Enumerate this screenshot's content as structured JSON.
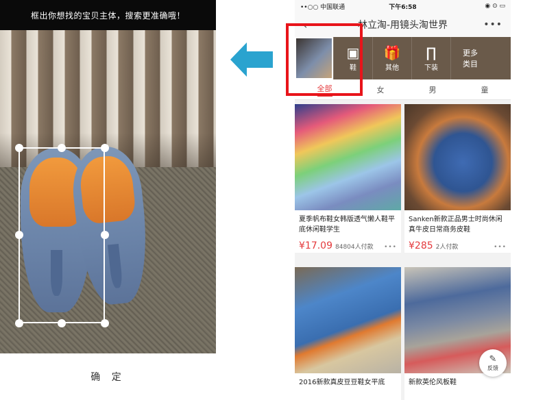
{
  "left_panel": {
    "hint": "框出你想找的宝贝主体，搜索更准确哦！",
    "confirm_label": "确 定"
  },
  "phone": {
    "status": {
      "carrier": "••○○ 中国联通",
      "time": "下午6:58",
      "battery": "◉ ⊙ ▭"
    },
    "nav": {
      "back": "‹",
      "title": "林立淘-用镜头淘世界",
      "more": "•••"
    },
    "categories": [
      {
        "icon": "▣",
        "label": "鞋",
        "icon_name": "shoe-category-icon"
      },
      {
        "icon": "🎁",
        "label": "其他",
        "icon_name": "gift-icon"
      },
      {
        "icon": "∏",
        "label": "下装",
        "icon_name": "pants-icon"
      },
      {
        "icon": "",
        "label": "更多\n类目",
        "icon_name": "more-categories"
      }
    ],
    "gender_tabs": [
      "全部",
      "女",
      "男",
      "童"
    ],
    "products": [
      {
        "desc": "夏季帆布鞋女韩版透气懒人鞋平底休闲鞋学生",
        "price": "¥17.09",
        "sold": "84804人付款",
        "dots": "•••"
      },
      {
        "desc": "Sanken新款正品男士时尚休闲真牛皮日常商务皮鞋",
        "price": "¥285",
        "sold": "2人付款",
        "dots": "•••"
      },
      {
        "desc": "2016新款真皮豆豆鞋女平底",
        "price": "",
        "sold": "",
        "dots": ""
      },
      {
        "desc": "新款英伦风板鞋",
        "price": "",
        "sold": "",
        "dots": ""
      }
    ],
    "feedback_label": "反馈"
  },
  "colors": {
    "accent": "#e4393c",
    "highlight": "#e8141a",
    "arrow": "#2aa3cf"
  }
}
